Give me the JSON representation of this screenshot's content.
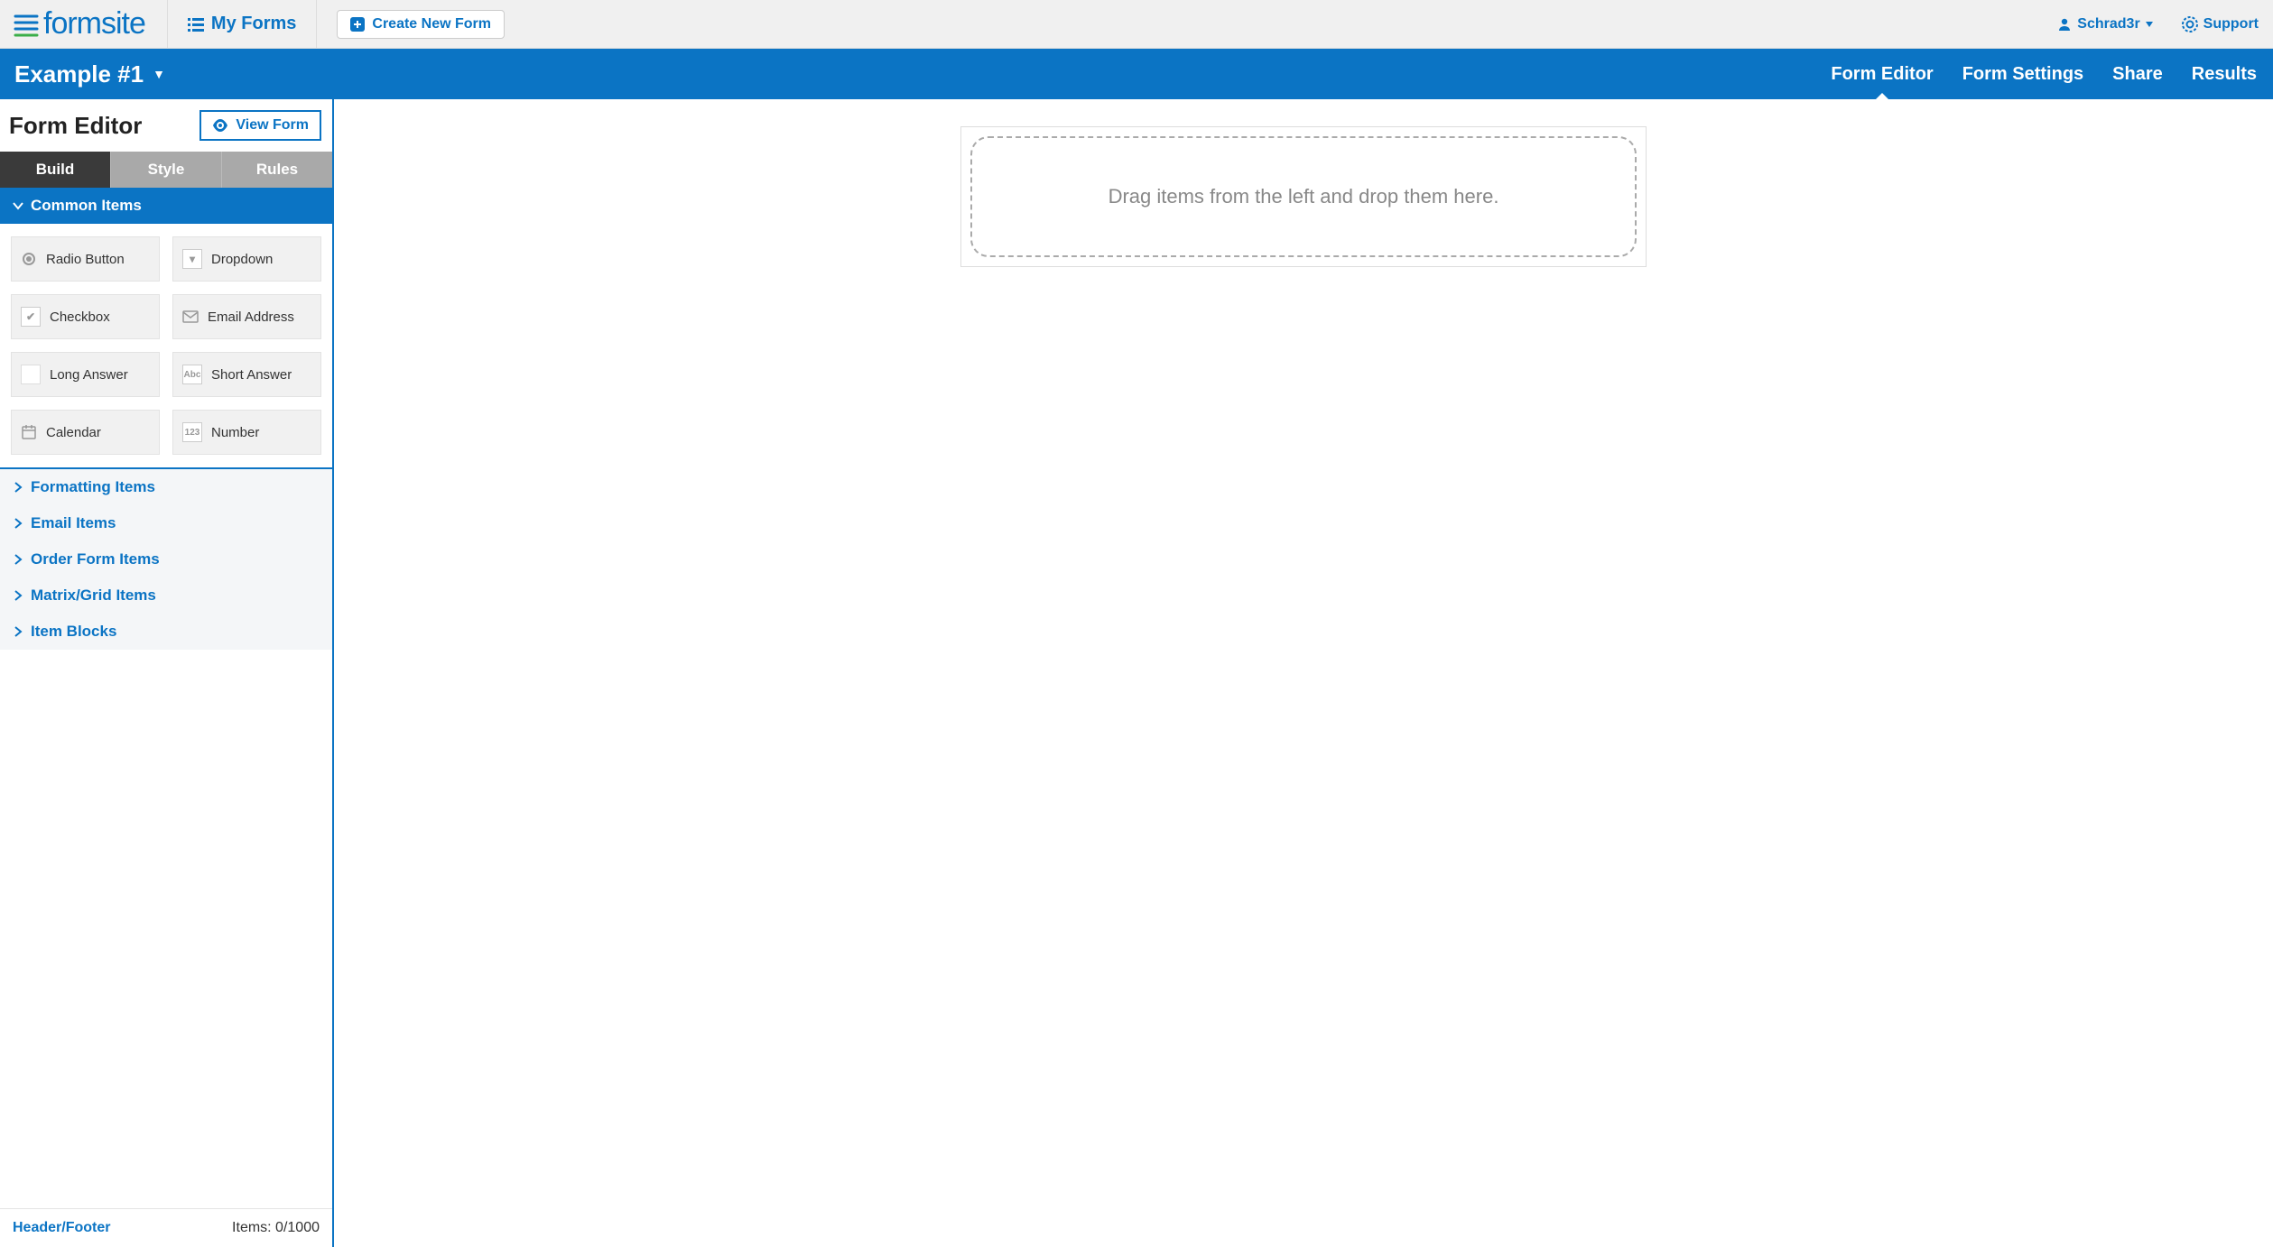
{
  "brand": "formsite",
  "topbar": {
    "my_forms": "My Forms",
    "create_new": "Create New Form",
    "user": "Schrad3r",
    "support": "Support"
  },
  "bluebar": {
    "form_name": "Example #1",
    "tabs": {
      "editor": "Form Editor",
      "settings": "Form Settings",
      "share": "Share",
      "results": "Results"
    }
  },
  "sidebar": {
    "title": "Form Editor",
    "view_form": "View Form",
    "editor_tabs": {
      "build": "Build",
      "style": "Style",
      "rules": "Rules"
    },
    "sections": {
      "common": "Common Items",
      "formatting": "Formatting Items",
      "email": "Email Items",
      "order": "Order Form Items",
      "matrix": "Matrix/Grid Items",
      "blocks": "Item Blocks"
    },
    "items": {
      "radio": "Radio Button",
      "dropdown": "Dropdown",
      "checkbox": "Checkbox",
      "emailaddr": "Email Address",
      "long": "Long Answer",
      "short": "Short Answer",
      "calendar": "Calendar",
      "number": "Number"
    },
    "footer": {
      "hf": "Header/Footer",
      "count": "Items: 0/1000"
    }
  },
  "canvas": {
    "drop_hint": "Drag items from the left and drop them here."
  }
}
